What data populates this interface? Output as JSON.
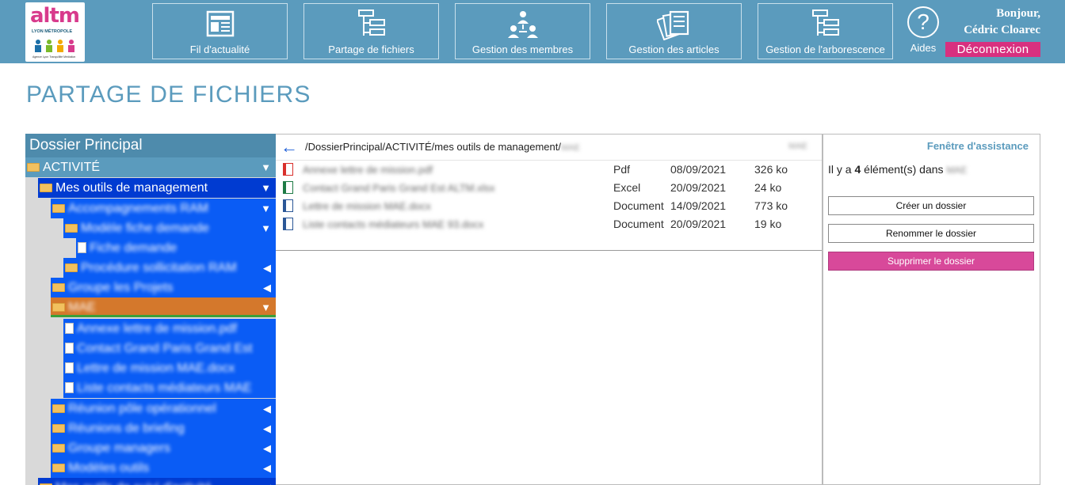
{
  "header": {
    "logo": {
      "brand": "altm",
      "subtitle": "LYON MÉTROPOLE",
      "tagline": "Agence Lyon Tranquillité Médiation"
    },
    "nav": [
      {
        "label": "Fil d'actualité",
        "icon": "newspaper-icon"
      },
      {
        "label": "Partage de fichiers",
        "icon": "file-tree-icon"
      },
      {
        "label": "Gestion des membres",
        "icon": "members-icon"
      },
      {
        "label": "Gestion des articles",
        "icon": "articles-icon"
      },
      {
        "label": "Gestion de l'arborescence",
        "icon": "tree-structure-icon"
      }
    ],
    "help": {
      "symbol": "?",
      "label": "Aides"
    },
    "greeting_line1": "Bonjour,",
    "greeting_line2": "Cédric Cloarec",
    "logout_label": "Déconnexion"
  },
  "page_title": "PARTAGE DE FICHIERS",
  "tree": {
    "title": "Dossier Principal",
    "items": [
      {
        "label": "ACTIVITÉ",
        "kind": "folder",
        "arrow": "▼"
      },
      {
        "label": "Mes outils de management",
        "kind": "folder",
        "arrow": "▼"
      },
      {
        "label": "Accompagnements RAM",
        "kind": "folder",
        "arrow": "▼"
      },
      {
        "label": "Modèle fiche demande",
        "kind": "folder",
        "arrow": "▼"
      },
      {
        "label": "Fiche demande",
        "kind": "file",
        "arrow": ""
      },
      {
        "label": "Procédure sollicitation RAM",
        "kind": "folder",
        "arrow": "◀"
      },
      {
        "label": "Groupe les Projets",
        "kind": "folder",
        "arrow": "◀"
      },
      {
        "label": "MAE",
        "kind": "folder",
        "arrow": "▼"
      },
      {
        "label": "Annexe lettre de mission.pdf",
        "kind": "file",
        "arrow": ""
      },
      {
        "label": "Contact Grand Paris Grand Est",
        "kind": "file",
        "arrow": ""
      },
      {
        "label": "Lettre de mission MAE.docx",
        "kind": "file",
        "arrow": ""
      },
      {
        "label": "Liste contacts médiateurs MAE",
        "kind": "file",
        "arrow": ""
      },
      {
        "label": "Réunion pôle opérationnel",
        "kind": "folder",
        "arrow": "◀"
      },
      {
        "label": "Réunions de briefing",
        "kind": "folder",
        "arrow": "◀"
      },
      {
        "label": "Groupe managers",
        "kind": "folder",
        "arrow": "◀"
      },
      {
        "label": "Modèles outils",
        "kind": "folder",
        "arrow": "◀"
      },
      {
        "label": "Mes outils de suivi d'activité",
        "kind": "folder",
        "arrow": "◀"
      }
    ]
  },
  "files": {
    "path": "/DossierPrincipal/ACTIVITÉ/mes outils de management/",
    "path_suffix": "MAE",
    "path_right": "MAE",
    "rows": [
      {
        "name": "Annexe lettre de mission.pdf",
        "type": "Pdf",
        "date": "08/09/2021",
        "size": "326 ko",
        "icon": "pdf-icon"
      },
      {
        "name": "Contact Grand Paris Grand Est ALTM.xlsx",
        "type": "Excel",
        "date": "20/09/2021",
        "size": "24 ko",
        "icon": "excel-icon"
      },
      {
        "name": "Lettre de mission MAE.docx",
        "type": "Document",
        "date": "14/09/2021",
        "size": "773 ko",
        "icon": "word-icon"
      },
      {
        "name": "Liste contacts médiateurs MAE 93.docx",
        "type": "Document",
        "date": "20/09/2021",
        "size": "19 ko",
        "icon": "word-icon"
      }
    ]
  },
  "assist": {
    "title": "Fenêtre d'assistance",
    "count_prefix": "Il y a",
    "count": "4",
    "count_suffix": "élément(s) dans",
    "count_folder": "MAE",
    "buttons": {
      "create": "Créer un dossier",
      "rename": "Renommer le dossier",
      "delete": "Supprimer le dossier"
    }
  },
  "colors": {
    "header_bg": "#5b9bbd",
    "accent_pink": "#d8307f",
    "tree_selected": "#003bd1",
    "tree_item": "#0a5cf5",
    "tree_active_orange": "#d4782c"
  }
}
